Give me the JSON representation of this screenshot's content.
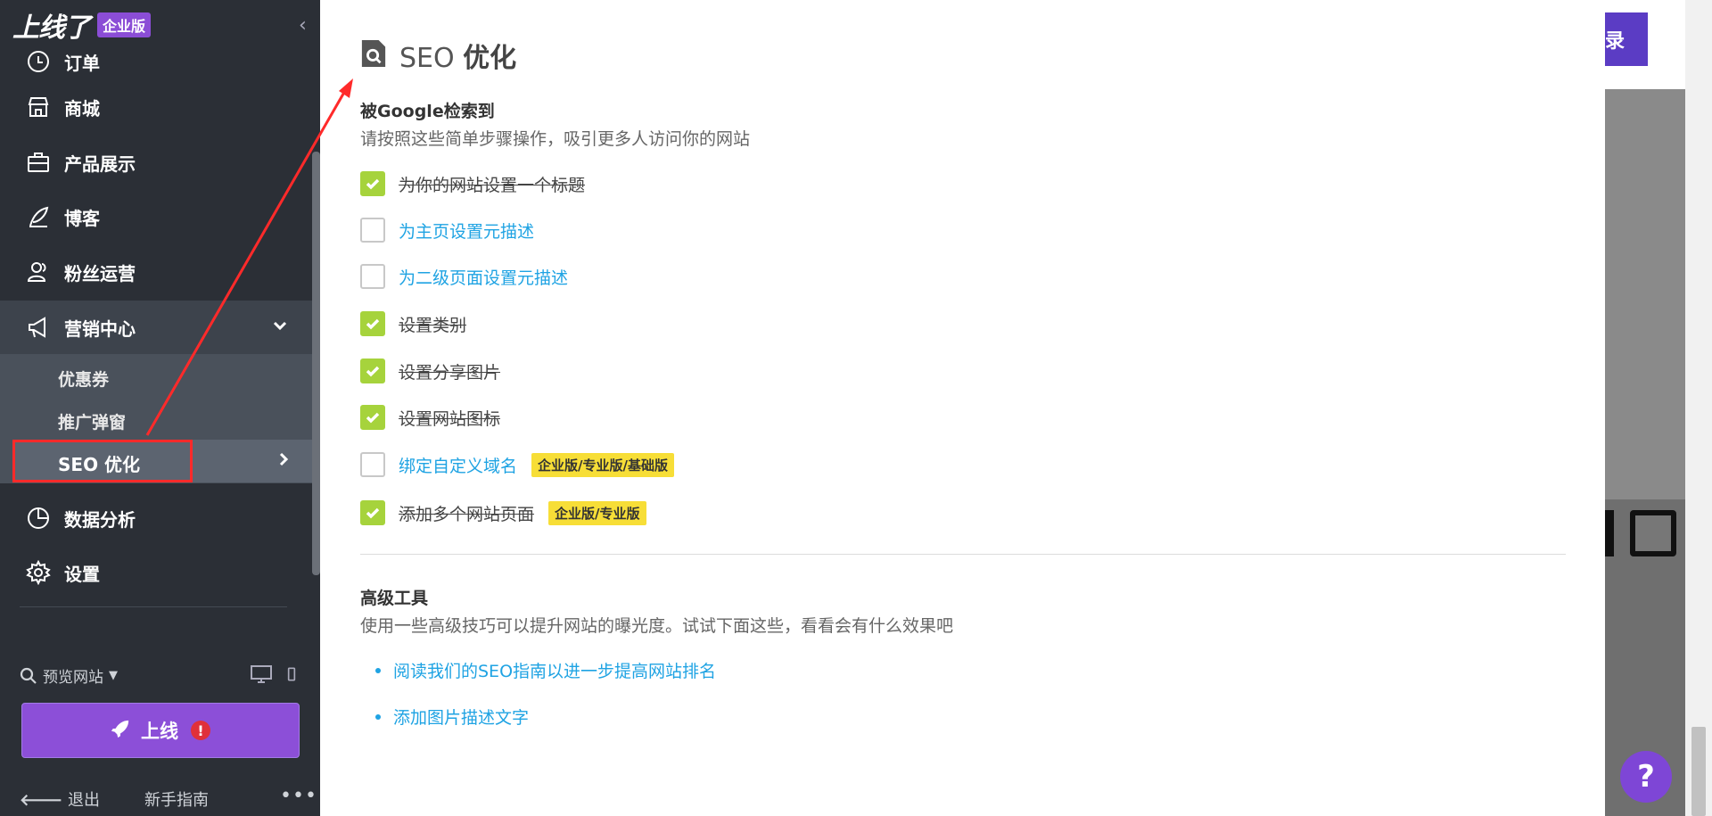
{
  "sidebar": {
    "brand": "上线了",
    "edition_badge": "企业版",
    "items": [
      {
        "label": "订单",
        "icon": "order-icon"
      },
      {
        "label": "商城",
        "icon": "store-icon"
      },
      {
        "label": "产品展示",
        "icon": "briefcase-icon"
      },
      {
        "label": "博客",
        "icon": "quill-icon"
      },
      {
        "label": "粉丝运营",
        "icon": "users-icon"
      },
      {
        "label": "营销中心",
        "icon": "megaphone-icon"
      },
      {
        "label": "数据分析",
        "icon": "pie-chart-icon"
      },
      {
        "label": "设置",
        "icon": "gear-icon"
      }
    ],
    "submenu": [
      "优惠券",
      "推广弹窗",
      "SEO 优化"
    ],
    "preview_label": "预览网站",
    "publish_label": "上线",
    "publish_alert": "!",
    "logout_label": "退出",
    "guide_label": "新手指南",
    "more_label": "•••"
  },
  "panel": {
    "title_prefix": "SEO",
    "title_suffix": "优化",
    "google": {
      "title": "被Google检索到",
      "desc": "请按照这些简单步骤操作，吸引更多人访问你的网站",
      "items": [
        {
          "label": "为你的网站设置一个标题",
          "done": true,
          "tag": ""
        },
        {
          "label": "为主页设置元描述",
          "done": false,
          "tag": ""
        },
        {
          "label": "为二级页面设置元描述",
          "done": false,
          "tag": ""
        },
        {
          "label": "设置类别",
          "done": true,
          "tag": ""
        },
        {
          "label": "设置分享图片",
          "done": true,
          "tag": ""
        },
        {
          "label": "设置网站图标",
          "done": true,
          "tag": ""
        },
        {
          "label": "绑定自定义域名",
          "done": false,
          "tag": "企业版/专业版/基础版"
        },
        {
          "label": "添加多个网站页面",
          "done": true,
          "tag": "企业版/专业版"
        }
      ]
    },
    "advanced": {
      "title": "高级工具",
      "desc": "使用一些高级技巧可以提升网站的曝光度。试试下面这些，看看会有什么效果吧",
      "links": [
        "阅读我们的SEO指南以进一步提高网站排名",
        "添加图片描述文字"
      ]
    }
  },
  "background": {
    "login_fragment": "录",
    "help_label": "?"
  },
  "colors": {
    "sidebar_bg": "#2b2f36",
    "accent_purple": "#8c4fd8",
    "check_green": "#a6d33c",
    "link_blue": "#1fa3e3",
    "tag_yellow": "#f7de37",
    "annotation_red": "#ff2a2a"
  }
}
